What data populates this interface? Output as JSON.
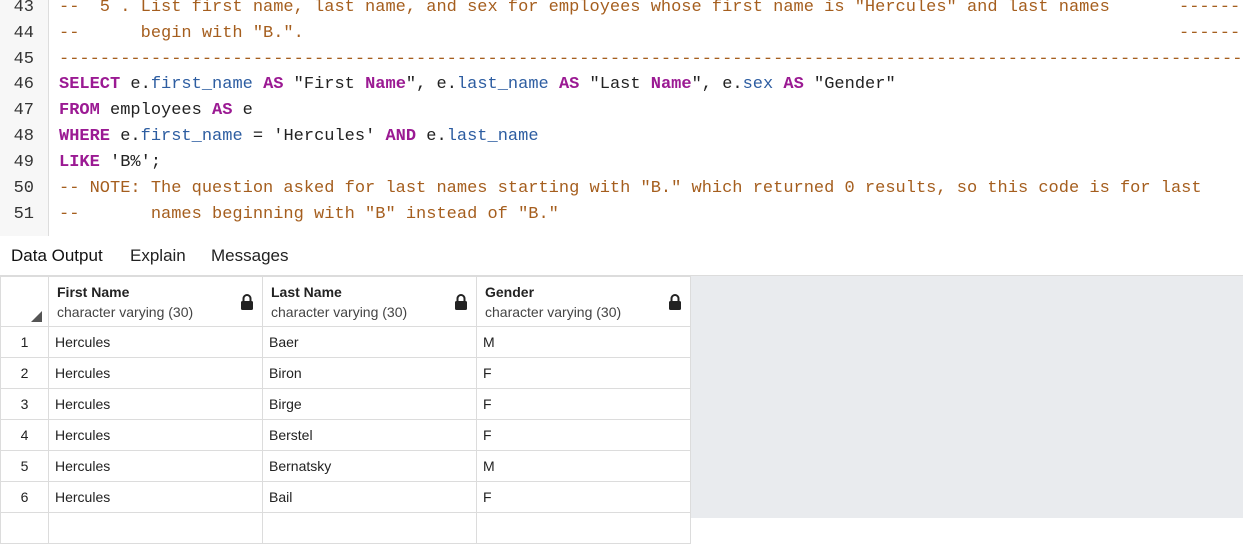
{
  "editor": {
    "lines": [
      {
        "num": "43",
        "text": "--  5 . List first name, last name, and sex for employees whose first name is \"Hercules\" and last names",
        "right": "------"
      },
      {
        "num": "44",
        "text": "--      begin with \"B.\".",
        "right": "------"
      },
      {
        "num": "45",
        "text": "-----------------------------------------------------------------------------------------------------------------------"
      },
      {
        "num": "46",
        "parts": [
          {
            "t": "SELECT",
            "c": "kw"
          },
          {
            "t": " e.",
            "c": "tx"
          },
          {
            "t": "first_name",
            "c": "fld"
          },
          {
            "t": " ",
            "c": "tx"
          },
          {
            "t": "AS",
            "c": "kw"
          },
          {
            "t": " \"First ",
            "c": "st"
          },
          {
            "t": "Name",
            "c": "kw"
          },
          {
            "t": "\", e.",
            "c": "st"
          },
          {
            "t": "last_name",
            "c": "fld"
          },
          {
            "t": " ",
            "c": "tx"
          },
          {
            "t": "AS",
            "c": "kw"
          },
          {
            "t": " \"Last ",
            "c": "st"
          },
          {
            "t": "Name",
            "c": "kw"
          },
          {
            "t": "\", e.",
            "c": "st"
          },
          {
            "t": "sex",
            "c": "fld"
          },
          {
            "t": " ",
            "c": "tx"
          },
          {
            "t": "AS",
            "c": "kw"
          },
          {
            "t": " \"Gender\"",
            "c": "st"
          }
        ]
      },
      {
        "num": "47",
        "parts": [
          {
            "t": "FROM",
            "c": "kw"
          },
          {
            "t": " employees ",
            "c": "tx"
          },
          {
            "t": "AS",
            "c": "kw"
          },
          {
            "t": " e",
            "c": "tx"
          }
        ]
      },
      {
        "num": "48",
        "parts": [
          {
            "t": "WHERE",
            "c": "kw"
          },
          {
            "t": " e.",
            "c": "tx"
          },
          {
            "t": "first_name",
            "c": "fld"
          },
          {
            "t": " = 'Hercules' ",
            "c": "tx"
          },
          {
            "t": "AND",
            "c": "kw"
          },
          {
            "t": " e.",
            "c": "tx"
          },
          {
            "t": "last_name",
            "c": "fld"
          }
        ]
      },
      {
        "num": "49",
        "parts": [
          {
            "t": "LIKE",
            "c": "kw"
          },
          {
            "t": " 'B%';",
            "c": "tx"
          }
        ]
      },
      {
        "num": "50",
        "text": "-- NOTE: The question asked for last names starting with \"B.\" which returned 0 results, so this code is for last"
      },
      {
        "num": "51",
        "text": "--       names beginning with \"B\" instead of \"B.\""
      }
    ]
  },
  "tabs": [
    "Data Output",
    "Explain",
    "Messages"
  ],
  "grid": {
    "columns": [
      {
        "name": "First Name",
        "type": "character varying (30)"
      },
      {
        "name": "Last Name",
        "type": "character varying (30)"
      },
      {
        "name": "Gender",
        "type": "character varying (30)"
      }
    ],
    "rows": [
      {
        "n": "1",
        "cells": [
          "Hercules",
          "Baer",
          "M"
        ]
      },
      {
        "n": "2",
        "cells": [
          "Hercules",
          "Biron",
          "F"
        ]
      },
      {
        "n": "3",
        "cells": [
          "Hercules",
          "Birge",
          "F"
        ]
      },
      {
        "n": "4",
        "cells": [
          "Hercules",
          "Berstel",
          "F"
        ]
      },
      {
        "n": "5",
        "cells": [
          "Hercules",
          "Bernatsky",
          "M"
        ]
      },
      {
        "n": "6",
        "cells": [
          "Hercules",
          "Bail",
          "F"
        ]
      },
      {
        "n": "",
        "cells": [
          "",
          "",
          ""
        ]
      }
    ]
  },
  "colors": {
    "comment": "#a55e1e",
    "keyword": "#9b1a93",
    "field": "#2d5da1"
  },
  "icons": {
    "column_lock": "lock-icon",
    "corner": "sort-triangle-icon"
  }
}
